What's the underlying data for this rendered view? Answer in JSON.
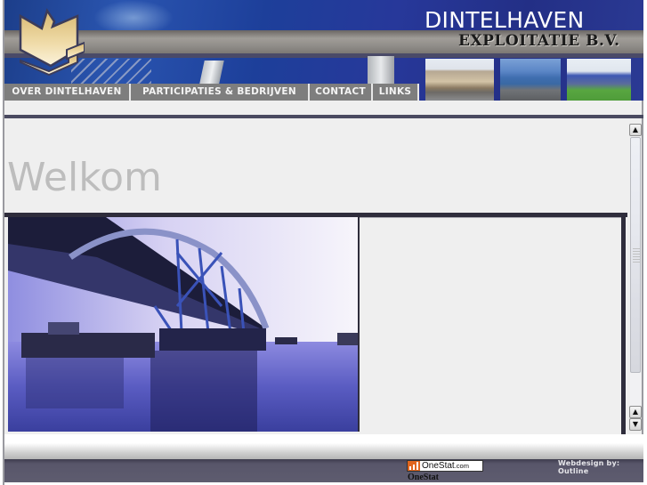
{
  "header": {
    "title_line1": "DINTELHAVEN",
    "title_line2": "EXPLOITATIE B.V.",
    "logo": "dintelhaven-logo-icon",
    "photos": [
      "office-building-photo",
      "warehouse-photo",
      "company-building-photo"
    ]
  },
  "nav": {
    "items": [
      {
        "label": "OVER DINTELHAVEN"
      },
      {
        "label": "PARTICIPATIES & BEDRIJVEN"
      },
      {
        "label": "CONTACT"
      },
      {
        "label": "LINKS"
      }
    ]
  },
  "main": {
    "heading": "Welkom",
    "image": "bridge-transport-photo"
  },
  "colors": {
    "header_blue": "#2a4aa0",
    "nav_gray": "#7e7e7e",
    "dark_bar": "#2f2d3c",
    "heading_gray": "#bdbdbd",
    "onestat_orange": "#e0651d"
  },
  "footer": {
    "onestat_badge_main": "OneStat",
    "onestat_badge_suffix": ".com",
    "onestat_label": "OneStat",
    "credit": "Webdesign by: Outline"
  },
  "scrollbar": {
    "up_glyph": "▲",
    "down_glyph": "▼"
  }
}
